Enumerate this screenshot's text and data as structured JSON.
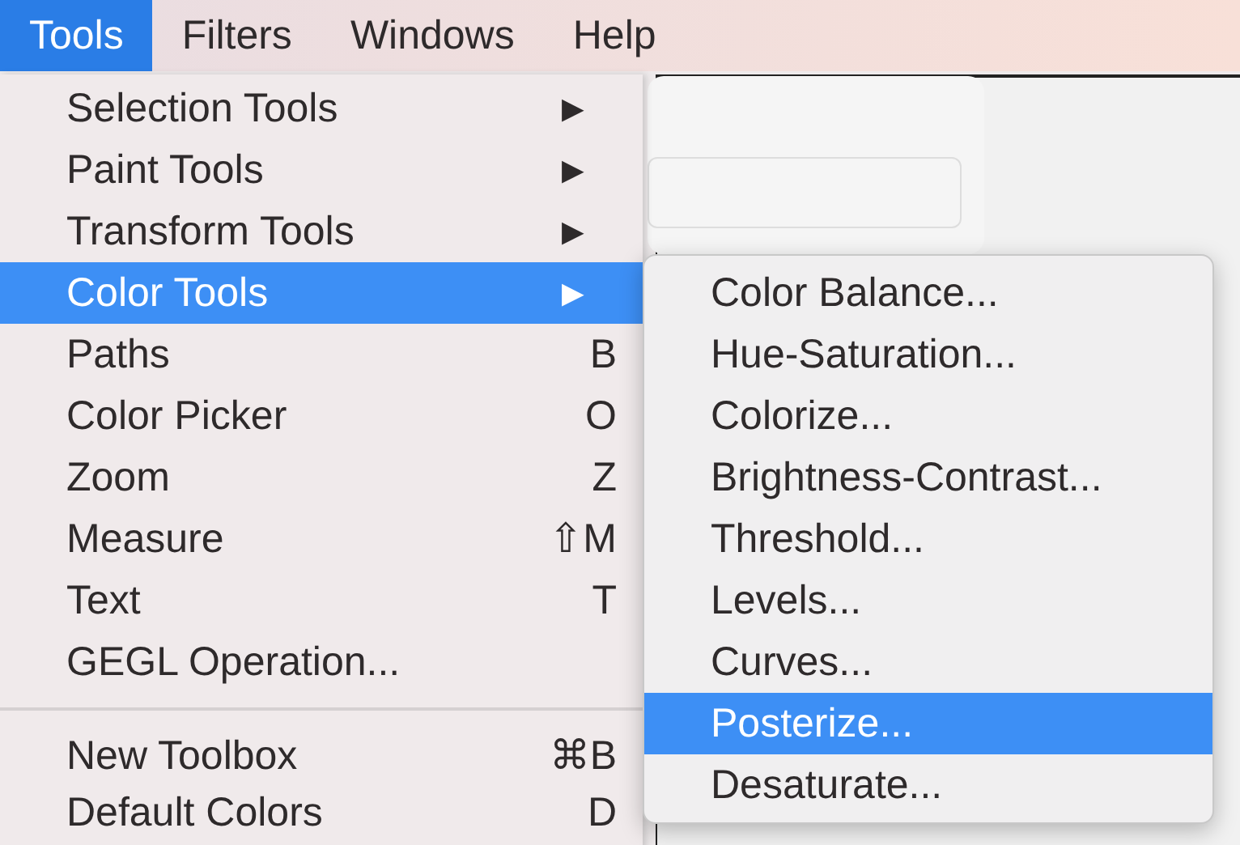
{
  "menubar": [
    {
      "label": "Tools",
      "selected": true
    },
    {
      "label": "Filters",
      "selected": false
    },
    {
      "label": "Windows",
      "selected": false
    },
    {
      "label": "Help",
      "selected": false
    }
  ],
  "tools_menu": {
    "items": [
      {
        "kind": "submenu",
        "label": "Selection Tools",
        "accessory": "▶",
        "selected": false
      },
      {
        "kind": "submenu",
        "label": "Paint Tools",
        "accessory": "▶",
        "selected": false
      },
      {
        "kind": "submenu",
        "label": "Transform Tools",
        "accessory": "▶",
        "selected": false
      },
      {
        "kind": "submenu",
        "label": "Color Tools",
        "accessory": "▶",
        "selected": true
      },
      {
        "kind": "command",
        "label": "Paths",
        "accessory": "B",
        "selected": false
      },
      {
        "kind": "command",
        "label": "Color Picker",
        "accessory": "O",
        "selected": false
      },
      {
        "kind": "command",
        "label": "Zoom",
        "accessory": "Z",
        "selected": false
      },
      {
        "kind": "command",
        "label": "Measure",
        "accessory": "⇧M",
        "selected": false
      },
      {
        "kind": "command",
        "label": "Text",
        "accessory": "T",
        "selected": false
      },
      {
        "kind": "command",
        "label": "GEGL Operation...",
        "selected": false
      },
      {
        "kind": "separator"
      },
      {
        "kind": "command",
        "label": "New Toolbox",
        "accessory": "⌘B",
        "selected": false
      },
      {
        "kind": "command",
        "label": "Default Colors",
        "accessory": "D",
        "selected": false
      }
    ]
  },
  "color_tools_submenu": {
    "items": [
      {
        "label": "Color Balance...",
        "selected": false
      },
      {
        "label": "Hue-Saturation...",
        "selected": false
      },
      {
        "label": "Colorize...",
        "selected": false
      },
      {
        "label": "Brightness-Contrast...",
        "selected": false
      },
      {
        "label": "Threshold...",
        "selected": false
      },
      {
        "label": "Levels...",
        "selected": false
      },
      {
        "label": "Curves...",
        "selected": false
      },
      {
        "label": "Posterize...",
        "selected": true
      },
      {
        "label": "Desaturate...",
        "selected": false
      }
    ]
  }
}
